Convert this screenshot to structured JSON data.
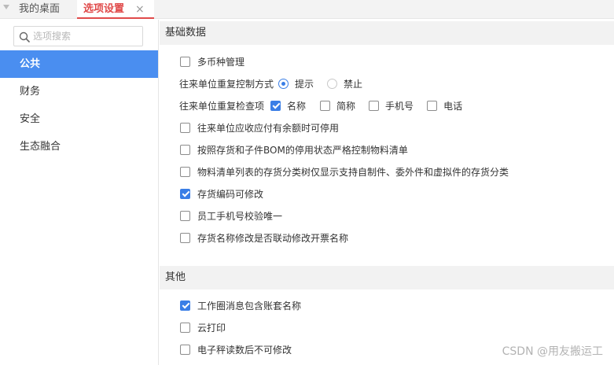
{
  "tabs": {
    "home_label": "我的桌面",
    "active_label": "选项设置",
    "close_glyph": "×"
  },
  "sidebar": {
    "search_placeholder": "选项搜索",
    "items": [
      {
        "label": "公共",
        "active": true
      },
      {
        "label": "财务",
        "active": false
      },
      {
        "label": "安全",
        "active": false
      },
      {
        "label": "生态融合",
        "active": false
      }
    ]
  },
  "sections": {
    "basic": {
      "title": "基础数据",
      "multi_currency": {
        "label": "多币种管理",
        "checked": false
      },
      "dup_control": {
        "label": "往来单位重复控制方式",
        "options": [
          {
            "label": "提示",
            "selected": true
          },
          {
            "label": "禁止",
            "selected": false
          }
        ]
      },
      "dup_check": {
        "label": "往来单位重复检查项",
        "options": [
          {
            "label": "名称",
            "checked": true
          },
          {
            "label": "简称",
            "checked": false
          },
          {
            "label": "手机号",
            "checked": false
          },
          {
            "label": "电话",
            "checked": false
          }
        ]
      },
      "opt_disable_balance": {
        "label": "往来单位应收应付有余额时可停用",
        "checked": false
      },
      "opt_bom_control": {
        "label": "按照存货和子件BOM的停用状态严格控制物料清单",
        "checked": false
      },
      "opt_bom_tree": {
        "label": "物料清单列表的存货分类树仅显示支持自制件、委外件和虚拟件的存货分类",
        "checked": false
      },
      "opt_code_editable": {
        "label": "存货编码可修改",
        "checked": true
      },
      "opt_phone_unique": {
        "label": "员工手机号校验唯一",
        "checked": false
      },
      "opt_name_link": {
        "label": "存货名称修改是否联动修改开票名称",
        "checked": false
      }
    },
    "other": {
      "title": "其他",
      "opt_workspace_msg": {
        "label": "工作圈消息包含账套名称",
        "checked": true
      },
      "opt_cloud_print": {
        "label": "云打印",
        "checked": false
      },
      "opt_scale_lock": {
        "label": "电子秤读数后不可修改",
        "checked": false
      }
    }
  },
  "watermark": "CSDN @用友搬运工",
  "colors": {
    "accent": "#3a7ee6",
    "nav_active": "#4a8ef0",
    "tab_active": "#e04a4a"
  }
}
